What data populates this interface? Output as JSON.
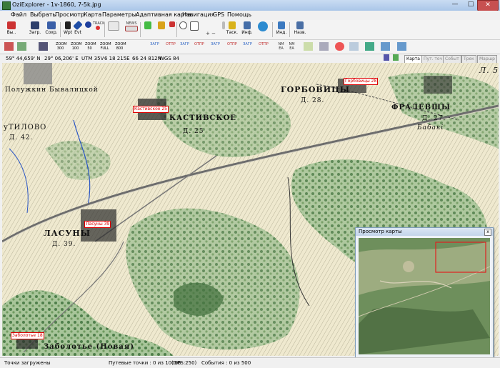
{
  "window": {
    "title": "OziExplorer - 1v-1860, 7-5k.jpg",
    "min": "—",
    "max": "□",
    "close": "✕"
  },
  "menu": [
    "Файл",
    "Выбрать",
    "Просмотр",
    "Карта",
    "Параметры",
    "Адаптивная карта",
    "Навигация",
    "GPS",
    "Помощь"
  ],
  "toolbar": {
    "exit": "Вы..",
    "load": "Загр.",
    "save": "Сохр.",
    "wpt": "Wpt",
    "evt": "Evt",
    "zoom_value": "100",
    "track": "Таск.",
    "info": "Инф.",
    "ind": "Инд.",
    "nav": "Назв.",
    "zoom_300": "ZOOM 300",
    "zoom_100": "ZOOM 100",
    "zoom_50": "ZOOM 50",
    "zoom_full": "ZOOM FULL",
    "zoom_800": "ZOOM 800",
    "track_label": "TRACK",
    "news_label": "NEWS"
  },
  "toolbar2": {
    "icon_labels": [
      "ЗАГР",
      "ЗАГР",
      "ОТПР",
      "ОТПР",
      "ЗАГР",
      "ОТПР",
      "ЗАГР",
      "ОТПР",
      "NM EA",
      "NM EA"
    ]
  },
  "position": {
    "lat": "59° 44,659' N",
    "lon": "29° 06,206' E",
    "utm": "UTM 35V",
    "easting": "6 18 215E",
    "northing": "66 24 812N",
    "datum": "WGS 84"
  },
  "map_tabs": [
    "Карта",
    "Пут. точ",
    "Событ",
    "Трек",
    "Маршр"
  ],
  "map": {
    "waypoints": [
      "Горбовицы 28",
      "Кастивское 25",
      "Ласуны 39",
      "Заболотье 18"
    ],
    "place_labels": [
      "ГОРБОВИЦЫ",
      "Д. 28.",
      "КАСТИВСКОЕ",
      "Д. 25",
      "ФРАЛЕВЩЫ",
      "Д. 27.",
      "Бабакі",
      "ЛАСУНЫ",
      "Д. 39.",
      "Заболотье (Новая)",
      "Полужкин Бывалицкой",
      "уТИЛОВО",
      "Д. 42.",
      "Л. 5"
    ]
  },
  "preview": {
    "title": "Просмотр карты",
    "close": "x"
  },
  "status": {
    "loaded": "Точки загружены",
    "waypoints": "Путевые точки : 0 из 10000",
    "gps": "(GPS:250)",
    "events": "События : 0 из 500"
  },
  "colors": {
    "titlebar": "#aac6e8",
    "map_bg": "#e9e6cf",
    "forest": "#5e8d5b",
    "waypoint": "#dd0000",
    "road": "#6d6d6d"
  }
}
